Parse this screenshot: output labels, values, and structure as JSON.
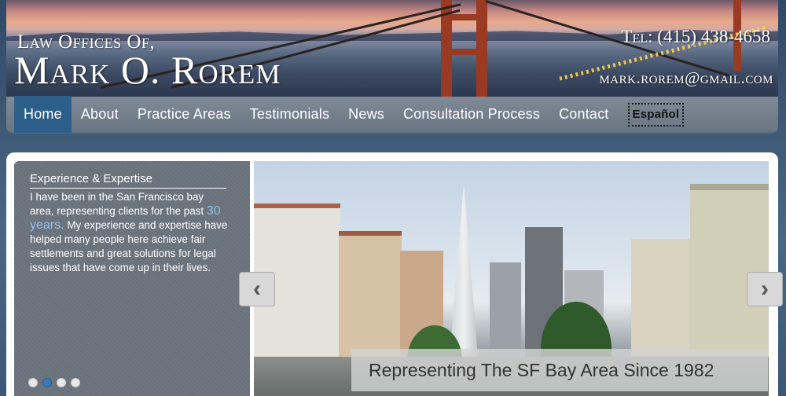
{
  "header": {
    "line1": "Law Offices Of,",
    "line2": "Mark O. Rorem",
    "phone": "Tel: (415) 438-4658",
    "email": "mark.rorem@gmail.com"
  },
  "nav": {
    "items": [
      {
        "label": "Home",
        "active": true
      },
      {
        "label": "About"
      },
      {
        "label": "Practice Areas"
      },
      {
        "label": "Testimonials"
      },
      {
        "label": "News"
      },
      {
        "label": "Consultation Process"
      },
      {
        "label": "Contact"
      },
      {
        "label": "Español"
      }
    ],
    "active_color": "#2e5e8a"
  },
  "sidebar": {
    "title": "Experience & Expertise",
    "text_before": "I have been in the San Francisco bay area, representing clients for the past",
    "highlight": "30 years.",
    "text_after": "My experience and expertise have helped many people here achieve fair settlements and great solutions for legal issues that have come up in their lives.",
    "dots": [
      false,
      true,
      false,
      false
    ]
  },
  "slider": {
    "caption": "Representing The SF Bay Area Since 1982",
    "prev_icon": "chevron-left-icon",
    "next_icon": "chevron-right-icon"
  }
}
